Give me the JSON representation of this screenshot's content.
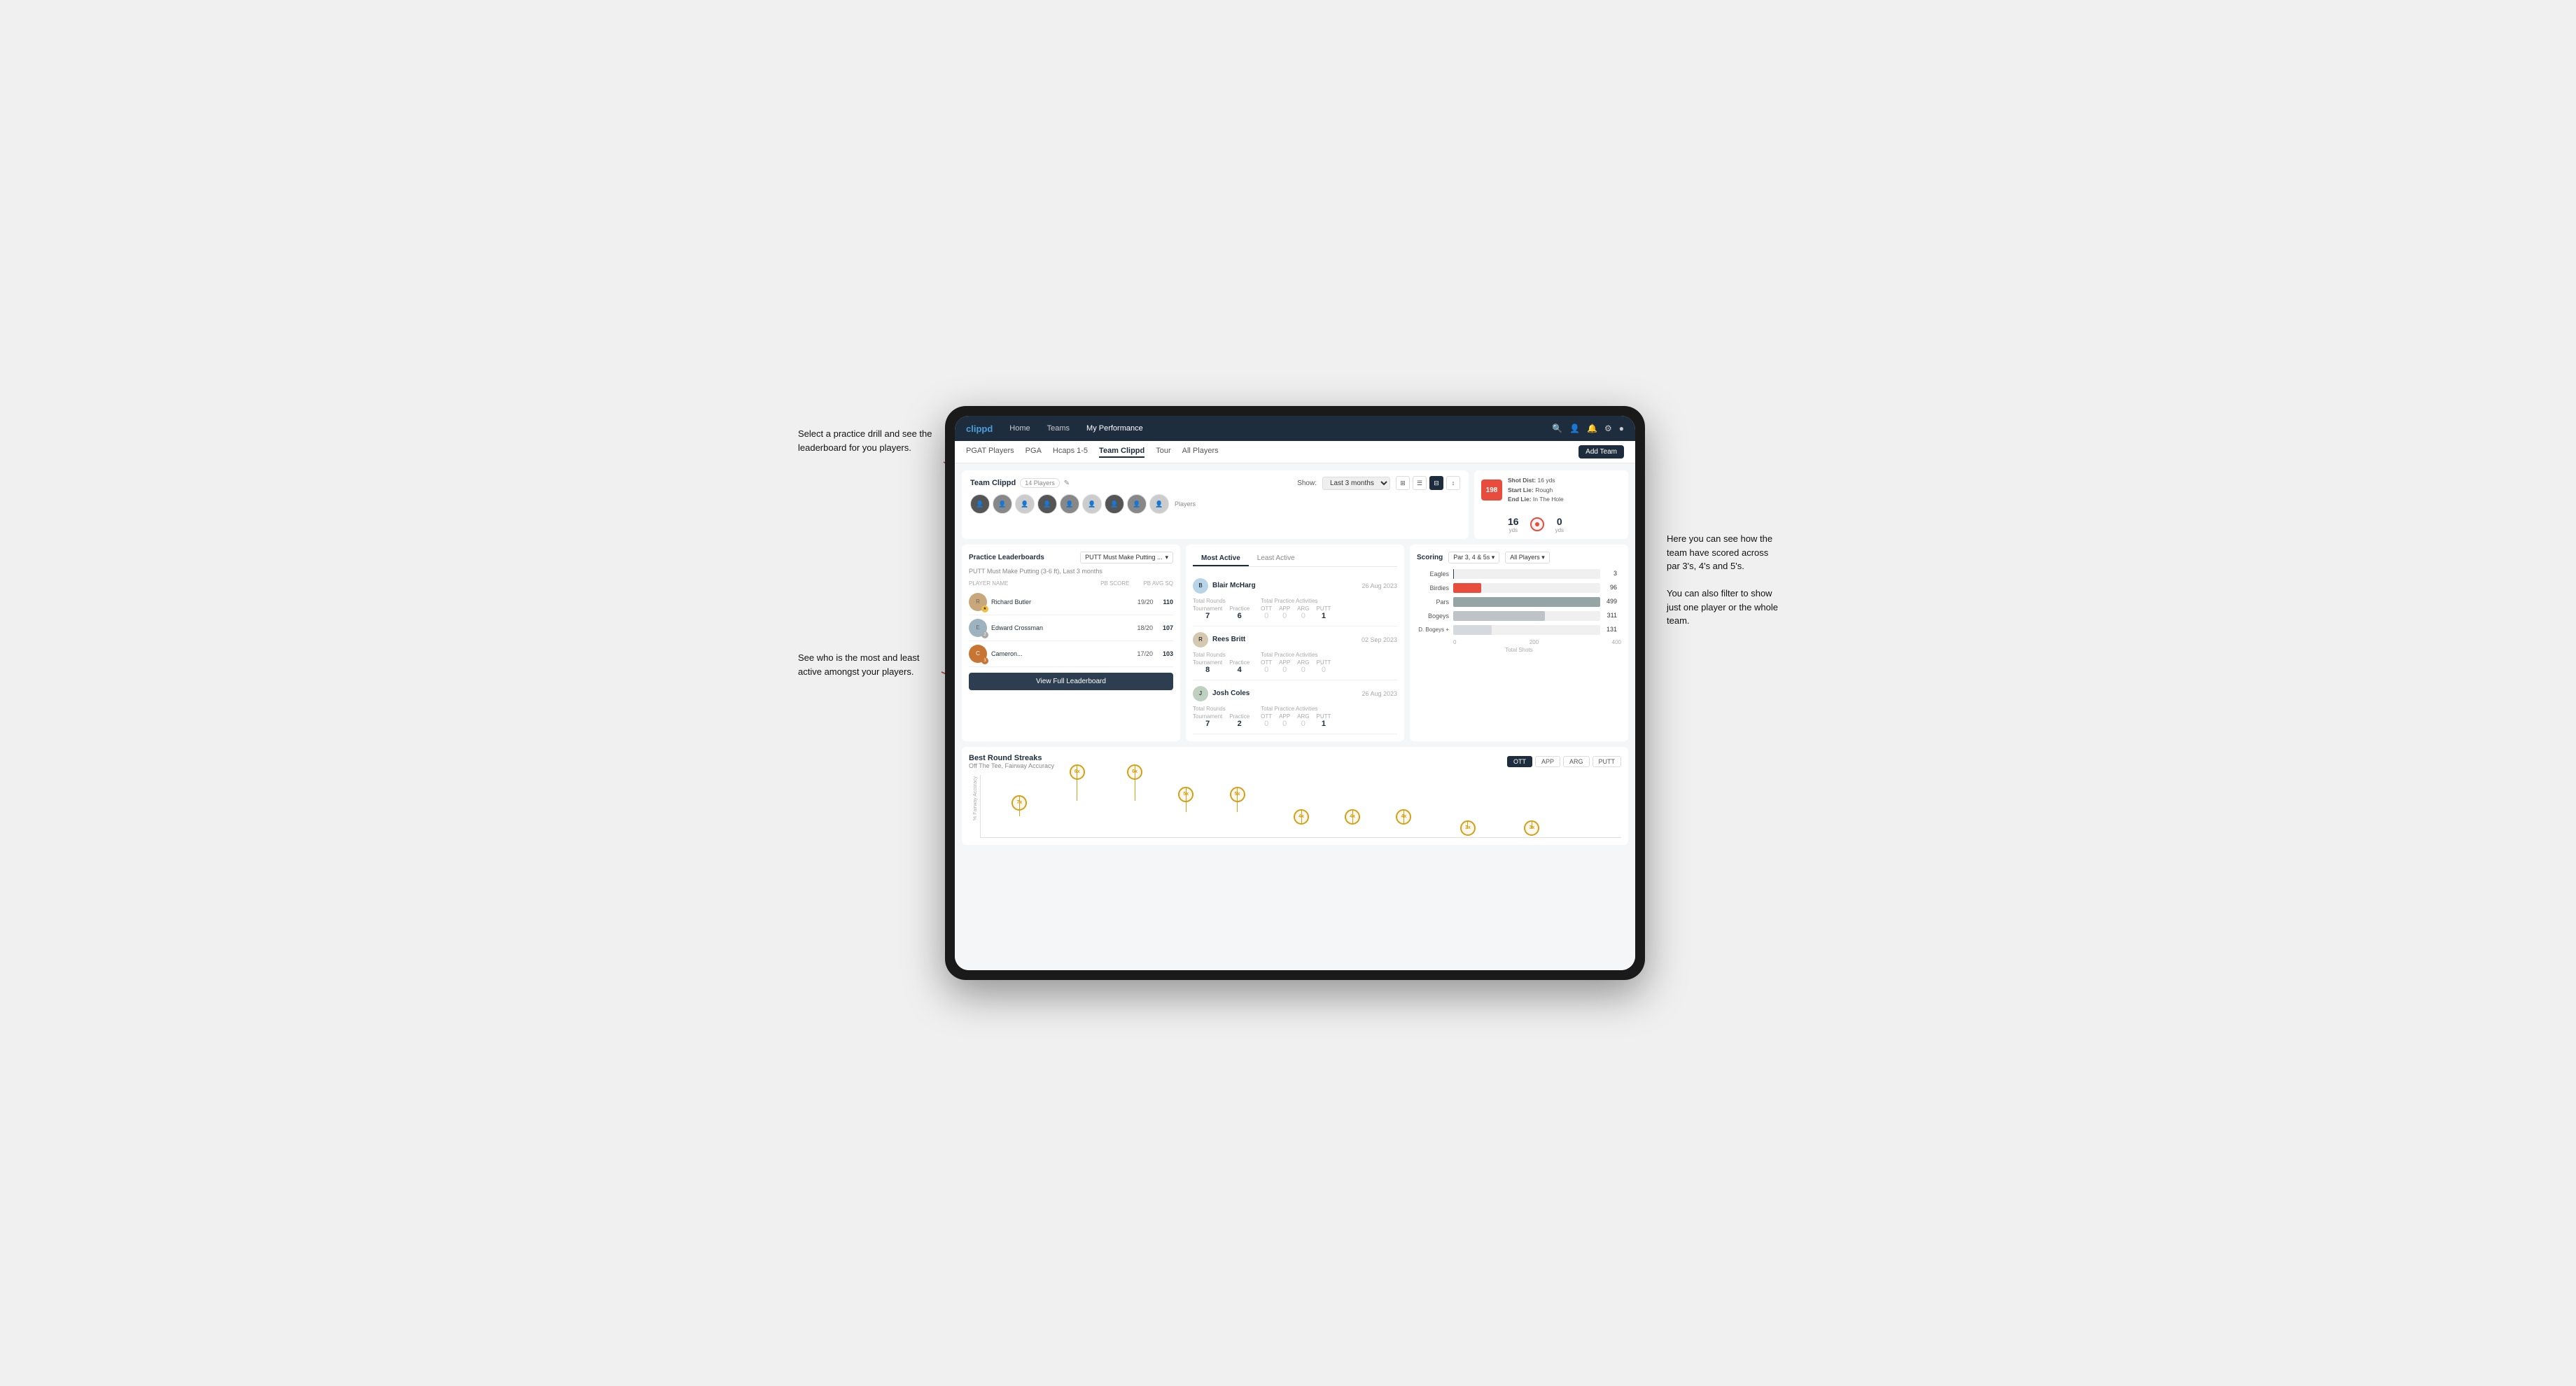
{
  "annotations": {
    "top_left": "Select a practice drill and see the leaderboard for you players.",
    "bottom_left": "See who is the most and least active amongst your players.",
    "top_right_line1": "Here you can see how the",
    "top_right_line2": "team have scored across",
    "top_right_line3": "par 3's, 4's and 5's.",
    "bottom_right_line1": "You can also filter to show",
    "bottom_right_line2": "just one player or the whole",
    "bottom_right_line3": "team."
  },
  "navbar": {
    "brand": "clippd",
    "links": [
      "Home",
      "Teams",
      "My Performance"
    ],
    "icons": [
      "search",
      "person",
      "bell",
      "settings",
      "user"
    ]
  },
  "subnav": {
    "links": [
      "PGAT Players",
      "PGA",
      "Hcaps 1-5",
      "Team Clippd",
      "Tour",
      "All Players"
    ],
    "active": "Team Clippd",
    "add_button": "Add Team"
  },
  "team_header": {
    "name": "Team Clippd",
    "count": "14 Players",
    "show_label": "Show:",
    "show_value": "Last 3 months",
    "players_label": "Players"
  },
  "shot_card": {
    "badge": "198",
    "shot_dist_label": "Shot Dist:",
    "shot_dist_val": "16 yds",
    "start_lie_label": "Start Lie:",
    "start_lie_val": "Rough",
    "end_lie_label": "End Lie:",
    "end_lie_val": "In The Hole",
    "yds1": "16",
    "yds1_label": "yds",
    "yds2": "0",
    "yds2_label": "yds"
  },
  "practice_leaderboards": {
    "title": "Practice Leaderboards",
    "dropdown": "PUTT Must Make Putting ...",
    "subtitle": "PUTT Must Make Putting (3-6 ft), Last 3 months",
    "col_player": "PLAYER NAME",
    "col_score": "PB SCORE",
    "col_avg": "PB AVG SQ",
    "players": [
      {
        "rank": 1,
        "name": "Richard Butler",
        "score": "19/20",
        "avg": "110",
        "badge": "gold",
        "badge_num": ""
      },
      {
        "rank": 2,
        "name": "Edward Crossman",
        "score": "18/20",
        "avg": "107",
        "badge": "silver",
        "badge_num": "2"
      },
      {
        "rank": 3,
        "name": "Cameron...",
        "score": "17/20",
        "avg": "103",
        "badge": "bronze",
        "badge_num": "3"
      }
    ],
    "view_full": "View Full Leaderboard"
  },
  "activity": {
    "tabs": [
      "Most Active",
      "Least Active"
    ],
    "active_tab": "Most Active",
    "players": [
      {
        "name": "Blair McHarg",
        "date": "26 Aug 2023",
        "total_rounds_label": "Total Rounds",
        "tournament_label": "Tournament",
        "tournament_val": "7",
        "practice_label": "Practice",
        "practice_val": "6",
        "total_practice_label": "Total Practice Activities",
        "ott_label": "OTT",
        "ott_val": "0",
        "app_label": "APP",
        "app_val": "0",
        "arg_label": "ARG",
        "arg_val": "0",
        "putt_label": "PUTT",
        "putt_val": "1"
      },
      {
        "name": "Rees Britt",
        "date": "02 Sep 2023",
        "total_rounds_label": "Total Rounds",
        "tournament_label": "Tournament",
        "tournament_val": "8",
        "practice_label": "Practice",
        "practice_val": "4",
        "total_practice_label": "Total Practice Activities",
        "ott_label": "OTT",
        "ott_val": "0",
        "app_label": "APP",
        "app_val": "0",
        "arg_label": "ARG",
        "arg_val": "0",
        "putt_label": "PUTT",
        "putt_val": "0"
      },
      {
        "name": "Josh Coles",
        "date": "26 Aug 2023",
        "total_rounds_label": "Total Rounds",
        "tournament_label": "Tournament",
        "tournament_val": "7",
        "practice_label": "Practice",
        "practice_val": "2",
        "total_practice_label": "Total Practice Activities",
        "ott_label": "OTT",
        "ott_val": "0",
        "app_label": "APP",
        "app_val": "0",
        "arg_label": "ARG",
        "arg_val": "0",
        "putt_label": "PUTT",
        "putt_val": "1"
      }
    ]
  },
  "scoring": {
    "title": "Scoring",
    "filter1": "Par 3, 4 & 5s ▾",
    "filter2": "All Players ▾",
    "bars": [
      {
        "label": "Eagles",
        "value": 3,
        "max": 500,
        "type": "eagles",
        "display": "3"
      },
      {
        "label": "Birdies",
        "value": 96,
        "max": 500,
        "type": "birdies",
        "display": "96"
      },
      {
        "label": "Pars",
        "value": 499,
        "max": 500,
        "type": "pars",
        "display": "499"
      },
      {
        "label": "Bogeys",
        "value": 311,
        "max": 500,
        "type": "bogeys",
        "display": "311"
      },
      {
        "label": "D. Bogeys +",
        "value": 131,
        "max": 500,
        "type": "dbogeys",
        "display": "131"
      }
    ],
    "x_labels": [
      "0",
      "200",
      "400"
    ],
    "x_title": "Total Shots"
  },
  "best_round_streaks": {
    "title": "Best Round Streaks",
    "subtitle": "Off The Tee, Fairway Accuracy",
    "tabs": [
      "OTT",
      "APP",
      "ARG",
      "PUTT"
    ],
    "active_tab": "OTT",
    "y_label": "% Fairway Accuracy",
    "bubbles": [
      {
        "label": "7x",
        "x_pct": 8,
        "y_pct": 20
      },
      {
        "label": "6x",
        "x_pct": 18,
        "y_pct": 55
      },
      {
        "label": "6x",
        "x_pct": 26,
        "y_pct": 55
      },
      {
        "label": "5x",
        "x_pct": 34,
        "y_pct": 35
      },
      {
        "label": "5x",
        "x_pct": 42,
        "y_pct": 35
      },
      {
        "label": "4x",
        "x_pct": 52,
        "y_pct": 20
      },
      {
        "label": "4x",
        "x_pct": 60,
        "y_pct": 20
      },
      {
        "label": "4x",
        "x_pct": 68,
        "y_pct": 20
      },
      {
        "label": "3x",
        "x_pct": 78,
        "y_pct": 10
      },
      {
        "label": "3x",
        "x_pct": 88,
        "y_pct": 10
      }
    ]
  }
}
